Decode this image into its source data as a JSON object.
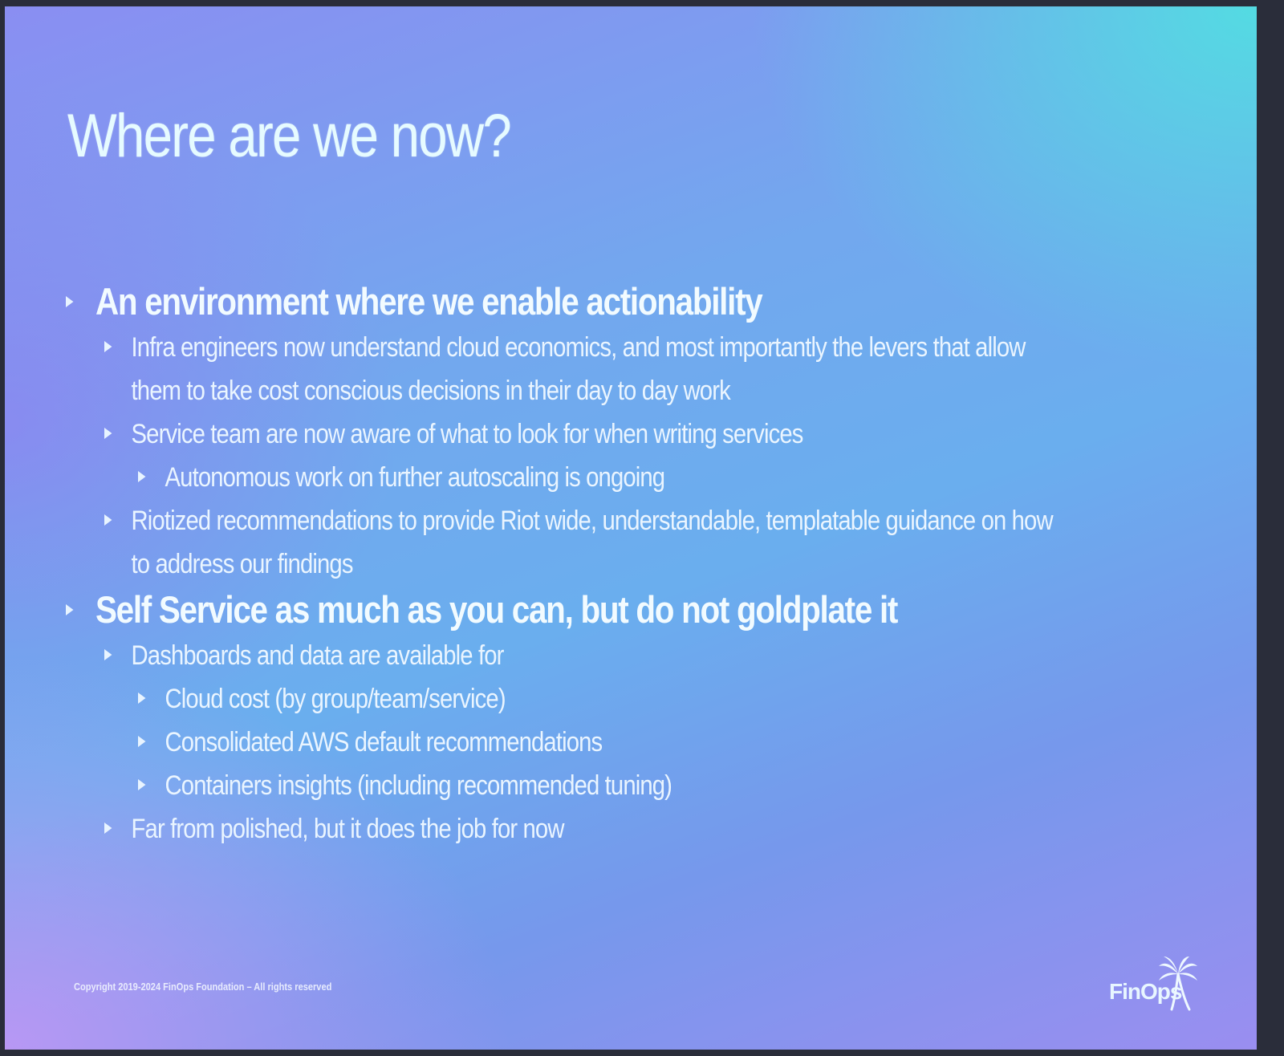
{
  "slide": {
    "title": "Where are we now?",
    "bullets": [
      {
        "level": 1,
        "text": "An environment where we enable actionability"
      },
      {
        "level": 2,
        "text": "Infra engineers  now understand cloud economics, and most importantly the levers that allow them to take cost conscious decisions in their day to day work"
      },
      {
        "level": 2,
        "text": "Service team are now aware of what to look for when writing services"
      },
      {
        "level": 3,
        "text": "Autonomous work on further autoscaling is ongoing"
      },
      {
        "level": 2,
        "text": "Riotized recommendations to provide Riot wide, understandable, templatable guidance on how to address our findings"
      },
      {
        "level": 1,
        "text": "Self Service as much as you can, but do not goldplate it"
      },
      {
        "level": 2,
        "text": "Dashboards  and data are available for"
      },
      {
        "level": 3,
        "text": "Cloud cost (by group/team/service)"
      },
      {
        "level": 3,
        "text": "Consolidated AWS default recommendations"
      },
      {
        "level": 3,
        "text": "Containers  insights (including recommended tuning)"
      },
      {
        "level": 2,
        "text": "Far from polished, but it does the job for now"
      }
    ],
    "footer": {
      "copyright": "Copyright 2019-2024 FinOps Foundation – All rights reserved",
      "logo_text": "FinOps"
    },
    "icons": {
      "bullet": "triangle-bullet-icon",
      "logo": "palm-tree-icon"
    },
    "colors": {
      "text": "#eef6ff",
      "title": "#e6fbff",
      "gradient_top_right": "#50e1e1",
      "gradient_bottom_left": "#c496f5",
      "gradient_mid": "#6aaeee"
    }
  }
}
